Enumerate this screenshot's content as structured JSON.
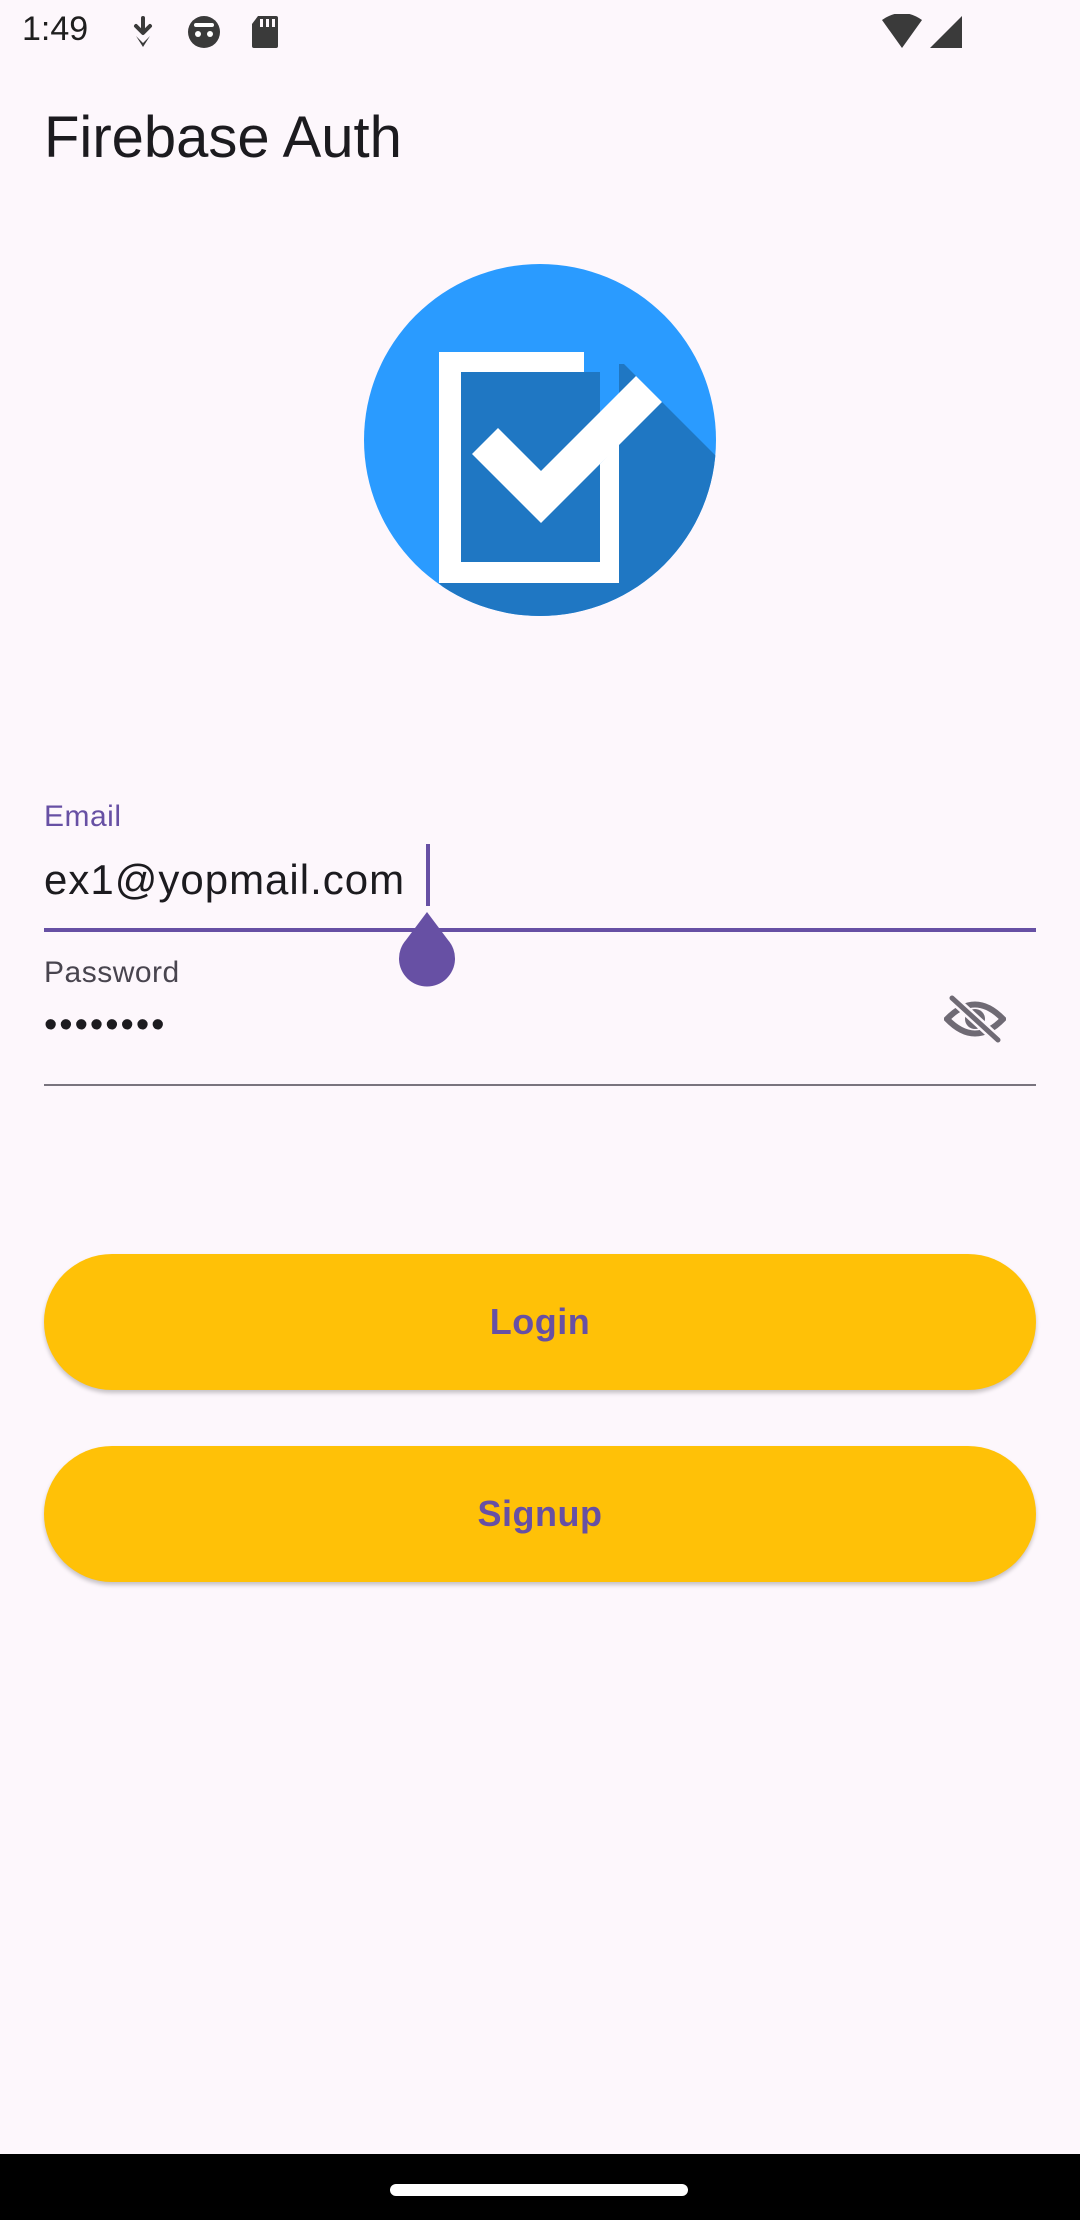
{
  "status_bar": {
    "time": "1:49",
    "left_icons": [
      "download-icon",
      "android-head-icon",
      "sd-card-icon"
    ],
    "right_icons": [
      "wifi-icon",
      "cell-signal-icon"
    ]
  },
  "app_bar": {
    "title": "Firebase Auth"
  },
  "logo": {
    "icon": "checkbox-check-icon",
    "colors": {
      "circle": "#2A9BFF",
      "shadow": "#1F77C3",
      "mark": "#FFFFFF"
    }
  },
  "form": {
    "email": {
      "label": "Email",
      "value": "ex1@yopmail.com",
      "focused": true
    },
    "password": {
      "label": "Password",
      "value": "••••••••",
      "toggle_icon": "visibility-off-icon"
    }
  },
  "buttons": {
    "login": "Login",
    "signup": "Signup"
  },
  "theme": {
    "background": "#FDF7FC",
    "primary": "#6750A4",
    "button": "#FFC107"
  }
}
